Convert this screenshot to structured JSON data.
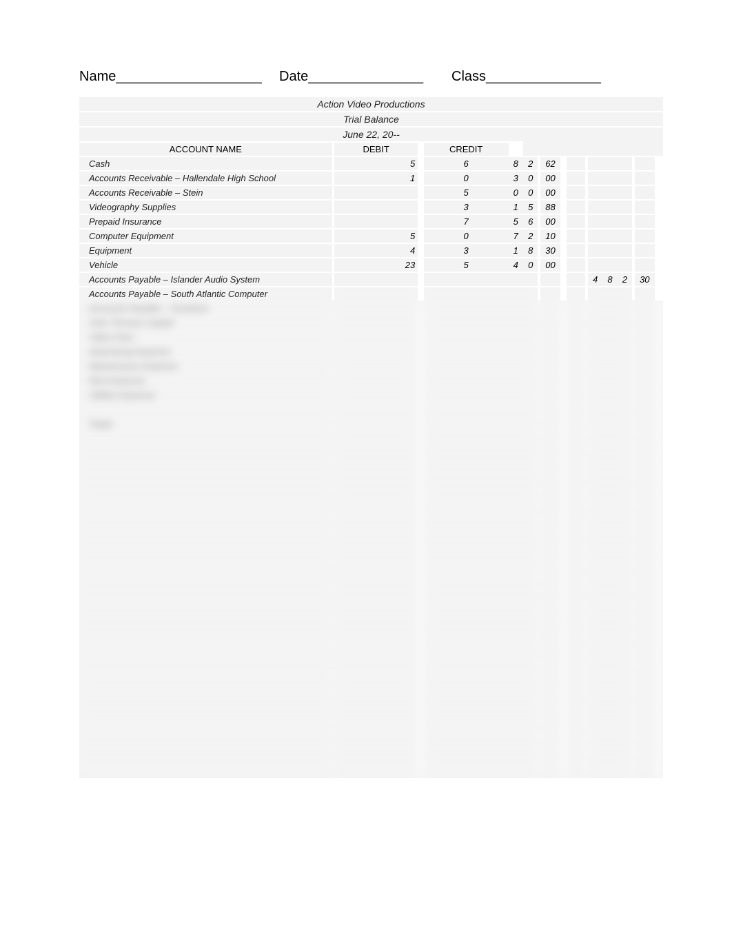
{
  "labels": {
    "name": "Name___________________",
    "date": "Date_______________",
    "class": "Class_______________"
  },
  "titles": {
    "company": "Action Video Productions",
    "report": "Trial Balance",
    "date": "June 22, 20--"
  },
  "headers": {
    "account": "ACCOUNT NAME",
    "debit": "DEBIT",
    "credit": "CREDIT"
  },
  "rows": [
    {
      "acct": "Cash",
      "debit": {
        "th": "5",
        "d1": "6",
        "d2": "8",
        "d3": "2",
        "c": "62"
      },
      "credit": null
    },
    {
      "acct": "Accounts Receivable – Hallendale High School",
      "debit": {
        "th": "1",
        "d1": "0",
        "d2": "3",
        "d3": "0",
        "c": "00"
      },
      "credit": null
    },
    {
      "acct": "Accounts Receivable – Stein",
      "debit": {
        "th": "",
        "d1": "5",
        "d2": "0",
        "d3": "0",
        "c": "00"
      },
      "credit": null
    },
    {
      "acct": "Videography Supplies",
      "debit": {
        "th": "",
        "d1": "3",
        "d2": "1",
        "d3": "5",
        "c": "88"
      },
      "credit": null
    },
    {
      "acct": "Prepaid Insurance",
      "debit": {
        "th": "",
        "d1": "7",
        "d2": "5",
        "d3": "6",
        "c": "00"
      },
      "credit": null
    },
    {
      "acct": "Computer Equipment",
      "debit": {
        "th": "5",
        "d1": "0",
        "d2": "7",
        "d3": "2",
        "c": "10"
      },
      "credit": null
    },
    {
      "acct": "Equipment",
      "debit": {
        "th": "4",
        "d1": "3",
        "d2": "1",
        "d3": "8",
        "c": "30"
      },
      "credit": null
    },
    {
      "acct": "Vehicle",
      "debit": {
        "th": "23",
        "d1": "5",
        "d2": "4",
        "d3": "0",
        "c": "00"
      },
      "credit": null
    },
    {
      "acct": "Accounts Payable – Islander Audio System",
      "debit": null,
      "credit": {
        "th": "",
        "d1": "4",
        "d2": "8",
        "d3": "2",
        "c": "30"
      }
    },
    {
      "acct": "Accounts Payable – South Atlantic Computer",
      "debit": null,
      "credit": null
    }
  ],
  "blurred_rows": [
    "Accounts Payable – Smothers",
    "John Thomas Capital",
    "Video Fees",
    "Advertising Expense",
    "Maintenance Expense",
    "Rent Expense",
    "Utilities Expense",
    "",
    "Totals"
  ],
  "blank_row_count": 24
}
